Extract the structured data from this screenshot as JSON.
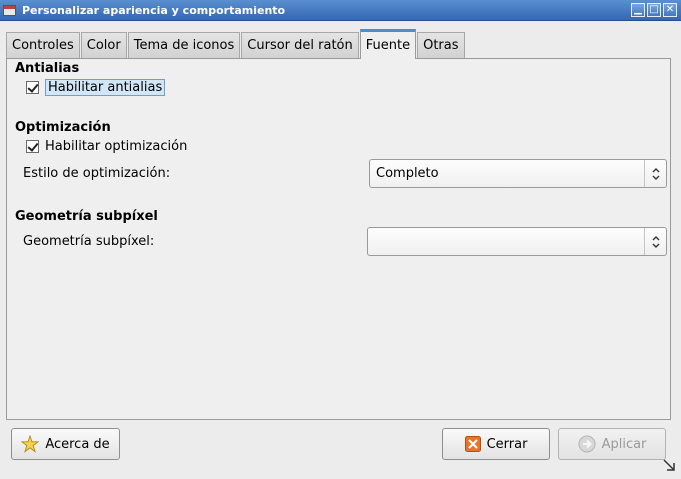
{
  "window": {
    "title": "Personalizar apariencia y comportamiento",
    "minimize_glyph": "▁",
    "maximize_glyph": "□",
    "close_glyph": "✕"
  },
  "tabs": [
    {
      "label": "Controles",
      "active": false
    },
    {
      "label": "Color",
      "active": false
    },
    {
      "label": "Tema de iconos",
      "active": false
    },
    {
      "label": "Cursor del ratón",
      "active": false
    },
    {
      "label": "Fuente",
      "active": true
    },
    {
      "label": "Otras",
      "active": false
    }
  ],
  "font": {
    "antialias": {
      "title": "Antialias",
      "checkbox_label": "Habilitar antialias",
      "checked": true
    },
    "hinting": {
      "title": "Optimización",
      "checkbox_label": "Habilitar optimización",
      "checked": true,
      "style_label": "Estilo de optimización:",
      "style_value": "Completo"
    },
    "subpixel": {
      "title": "Geometría subpíxel",
      "geometry_label": "Geometría subpíxel:",
      "geometry_value": ""
    }
  },
  "buttons": {
    "about": "Acerca de",
    "close": "Cerrar",
    "apply": "Aplicar"
  },
  "icons": {
    "about": "star-icon",
    "close": "close-icon",
    "apply": "apply-arrow-icon",
    "combo": "updown-arrows-icon"
  },
  "colors": {
    "titlebar": "#3f74bd",
    "active_tab_accent": "#4a8ed6",
    "close_icon": "#e8742a"
  }
}
